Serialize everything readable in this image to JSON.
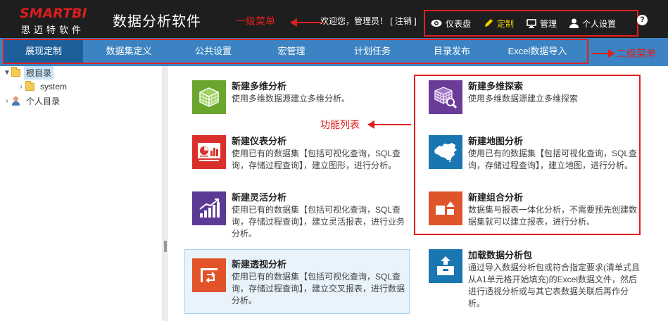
{
  "header": {
    "logo_main": "SMARTBI",
    "logo_sub": "思迈特软件",
    "app_title": "数据分析软件",
    "welcome": "欢迎您，管理员！",
    "logout": "[ 注销 ]",
    "menu1": [
      {
        "label": "仪表盘",
        "icon": "eye-icon"
      },
      {
        "label": "定制",
        "icon": "pencil-icon",
        "active": true
      },
      {
        "label": "管理",
        "icon": "monitor-icon"
      },
      {
        "label": "个人设置",
        "icon": "user-icon"
      }
    ],
    "help": "?"
  },
  "annotations": {
    "menu1": "一级菜单",
    "menu2": "二级菜单",
    "funclist": "功能列表"
  },
  "nav2": [
    {
      "label": "展现定制",
      "active": true
    },
    {
      "label": "数据集定义"
    },
    {
      "label": "公共设置"
    },
    {
      "label": "宏管理"
    },
    {
      "label": "计划任务"
    },
    {
      "label": "目录发布"
    },
    {
      "label": "Excel数据导入"
    }
  ],
  "tree": {
    "root": "根目录",
    "system": "system",
    "personal": "个人目录"
  },
  "cards": [
    {
      "title": "新建多维分析",
      "desc": "使用多维数据源建立多维分析。",
      "icon": "cube-icon",
      "color": "#6aa62d"
    },
    {
      "title": "新建仪表分析",
      "desc": "使用已有的数据集【包括可视化查询，SQL查询，存储过程查询】，建立图形，进行分析。",
      "icon": "dashboard-chart-icon",
      "color": "#d9302c"
    },
    {
      "title": "新建灵活分析",
      "desc": "使用已有的数据集【包括可视化查询，SQL查询，存储过程查询】，建立灵活报表，进行业务分析。",
      "icon": "bar-trend-icon",
      "color": "#5b3a96"
    },
    {
      "title": "新建透视分析",
      "desc": "使用已有的数据集【包括可视化查询，SQL查询，存储过程查询】，建立交叉报表，进行数据分析。",
      "icon": "pivot-icon",
      "color": "#e2532a"
    },
    {
      "title": "新建多维探索",
      "desc": "使用多维数据源建立多维探索",
      "icon": "cube-search-icon",
      "color": "#6b3c97"
    },
    {
      "title": "新建地图分析",
      "desc": "使用已有的数据集【包括可视化查询，SQL查询，存储过程查询】，建立地图，进行分析。",
      "icon": "china-map-icon",
      "color": "#1a76b0"
    },
    {
      "title": "新建组合分析",
      "desc": "数据集与报表一体化分析，不需要预先创建数据集就可以建立报表，进行分析。",
      "icon": "shapes-icon",
      "color": "#e0542a"
    },
    {
      "title": "加载数据分析包",
      "desc": "通过导入数据分析包或符合指定要求(清单式且从A1单元格开始填充)的Excel数据文件，然后进行透视分析或与其它表数据关联后再作分析。",
      "icon": "package-upload-icon",
      "color": "#1a76b0"
    }
  ]
}
